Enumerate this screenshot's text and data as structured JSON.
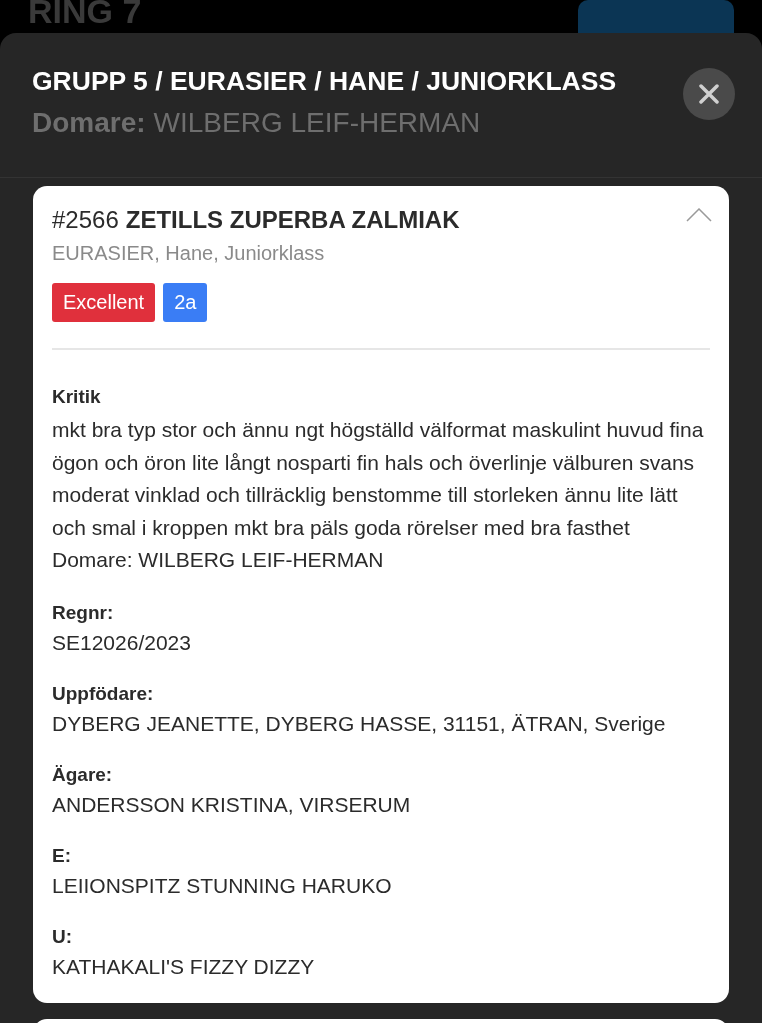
{
  "background": {
    "heading": "RING 7"
  },
  "modal": {
    "title": "GRUPP 5 / EURASIER / HANE / JUNIORKLASS",
    "judge_label": "Domare:",
    "judge_name": "WILBERG LEIF-HERMAN"
  },
  "entries": [
    {
      "number": "#2566",
      "name": "ZETILLS ZUPERBA ZALMIAK",
      "details": "EURASIER, Hane, Juniorklass",
      "expanded": true,
      "badges": [
        {
          "label": "Excellent",
          "color": "#e0303c"
        },
        {
          "label": "2a",
          "color": "#3a7df5"
        }
      ],
      "fields": [
        {
          "kind": "paragraph",
          "label": "Kritik",
          "value": "mkt bra typ stor och ännu ngt högställd välformat maskulint huvud fina ögon och öron lite långt nosparti fin hals och överlinje välburen svans moderat vinklad och tillräcklig benstomme till storleken ännu lite lätt och smal i kroppen mkt bra päls goda rörelser med bra fasthet Domare: WILBERG LEIF-HERMAN"
        },
        {
          "kind": "line",
          "label": "Regnr:",
          "value": "SE12026/2023"
        },
        {
          "kind": "line",
          "label": "Uppfödare:",
          "value": "DYBERG JEANETTE, DYBERG HASSE, 31151, ÄTRAN, Sverige"
        },
        {
          "kind": "line",
          "label": "Ägare:",
          "value": "ANDERSSON KRISTINA, VIRSERUM"
        },
        {
          "kind": "line",
          "label": "E:",
          "value": "LEIIONSPITZ STUNNING HARUKO"
        },
        {
          "kind": "line",
          "label": "U:",
          "value": "KATHAKALI'S FIZZY DIZZY"
        }
      ]
    }
  ]
}
